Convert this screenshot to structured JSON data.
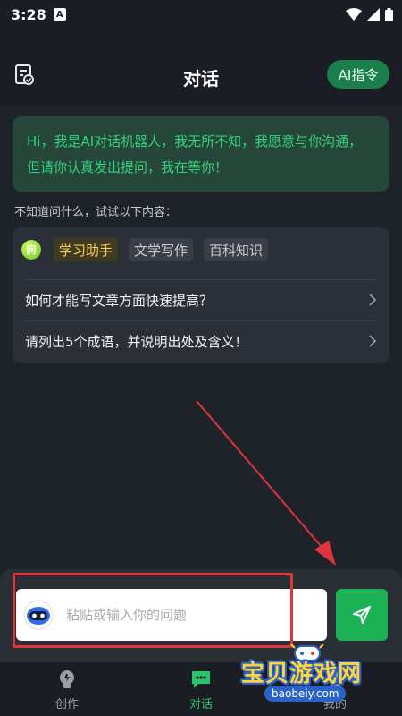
{
  "status_bar": {
    "time": "3:28",
    "a_badge": "A"
  },
  "header": {
    "title": "对话",
    "ai_command_label": "AI指令"
  },
  "greeting": {
    "text": "Hi，我是AI对话机器人，我无所不知，我愿意与你沟通，但请你认真发出提问，我在等你！"
  },
  "suggestions": {
    "hint": "不知道问什么，试试以下内容：",
    "q_badge": "问",
    "tabs": [
      {
        "label": "学习助手",
        "active": true
      },
      {
        "label": "文学写作",
        "active": false
      },
      {
        "label": "百科知识",
        "active": false
      }
    ],
    "items": [
      {
        "text": "如何才能写文章方面快速提高？"
      },
      {
        "text": "请列出5个成语，并说明出处及含义！"
      }
    ]
  },
  "input": {
    "placeholder": "粘贴或输入你的问题",
    "value": ""
  },
  "bottom_nav": [
    {
      "label": "创作",
      "icon": "lightbulb-icon",
      "active": false
    },
    {
      "label": "对话",
      "icon": "chat-icon",
      "active": true
    },
    {
      "label": "我的",
      "icon": "user-icon",
      "active": false
    }
  ],
  "watermark": {
    "text": "宝贝游戏网",
    "url": "baobeiy.com"
  },
  "colors": {
    "accent_green": "#1db156",
    "greeting_text": "#34d27b",
    "active_tab_text": "#f4d24a",
    "annotation_red": "#e0343c"
  }
}
